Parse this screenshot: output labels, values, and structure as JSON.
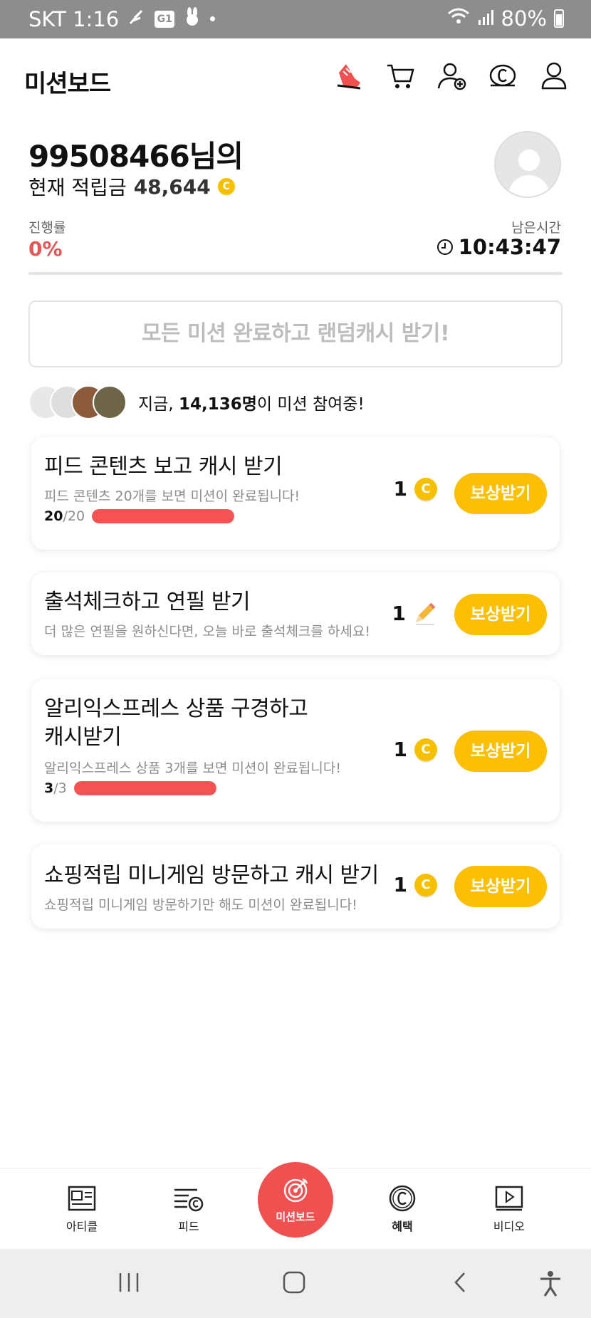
{
  "status_bar": {
    "carrier_time": "SKT 1:16",
    "g1": "G1",
    "battery": "80%"
  },
  "header": {
    "title": "미션보드"
  },
  "profile": {
    "username": "99508466님의",
    "points_label": "현재 적립금",
    "points_value": "48,644",
    "coin_symbol": "C",
    "progress_label": "진행률",
    "progress_value": "0%",
    "remaining_label": "남은시간",
    "remaining_value": "10:43:47"
  },
  "cta": {
    "label": "모든 미션 완료하고 랜덤캐시 받기!"
  },
  "participants": {
    "prefix": "지금, ",
    "count": "14,136명",
    "suffix": "이 미션 참여중!"
  },
  "missions": [
    {
      "title": "피드 콘텐츠 보고 캐시 받기",
      "desc": "피드 콘텐츠 20개를 보면 미션이 완료됩니다!",
      "progress_current": "20",
      "progress_total": "/20",
      "progress": 1.0,
      "reward": "1",
      "reward_icon": "coin-icon",
      "button": "보상받기"
    },
    {
      "title": "출석체크하고 연필 받기",
      "desc": "더 많은 연필을 원하신다면, 오늘 바로 출석체크를 하세요!",
      "reward": "1",
      "reward_icon": "pencil-icon",
      "button": "보상받기"
    },
    {
      "title_line1": "알리익스프레스 상품 구경하고",
      "title_line2": "캐시받기",
      "desc": "알리익스프레스 상품 3개를 보면 미션이 완료됩니다!",
      "progress_current": "3",
      "progress_total": "/3",
      "progress": 1.0,
      "reward": "1",
      "reward_icon": "coin-icon",
      "button": "보상받기"
    },
    {
      "title": "쇼핑적립 미니게임 방문하고 캐시 받기",
      "desc": "쇼핑적립 미니게임 방문하기만 해도 미션이 완료됩니다!",
      "reward": "1",
      "reward_icon": "coin-icon",
      "button": "보상받기"
    }
  ],
  "bottom_nav": {
    "article": "아티클",
    "feed": "피드",
    "missionboard": "미션보드",
    "benefit": "혜택",
    "video": "비디오"
  },
  "colors": {
    "accent_red": "#f05050",
    "button_yellow": "#fcbf06",
    "progress_red": "#f35353",
    "coin": "#f6c000"
  }
}
